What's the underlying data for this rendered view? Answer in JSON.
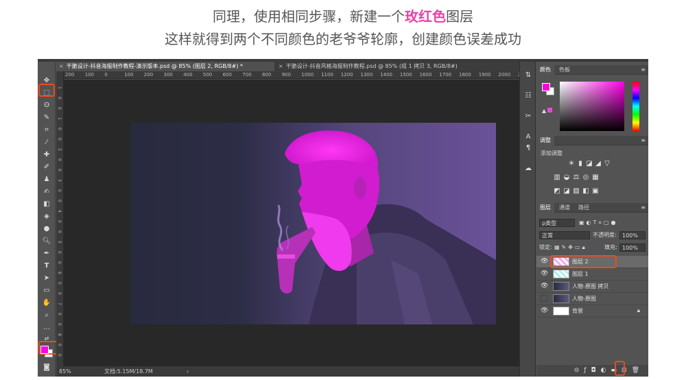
{
  "caption": {
    "line1_a": "同理，使用相同步骤，新建一个",
    "line1_hl": "玫红色",
    "line1_b": "图层",
    "line2": "这样就得到两个不同颜色的老爷爷轮廓，创建颜色误差成功"
  },
  "tabs": [
    {
      "close": "×",
      "label": "干脆设计-抖音海报制作教程-演示版本.psd @ 85% (图层 2, RGB/8#) *"
    },
    {
      "close": "×",
      "label": "干脆设计-抖音风格海报制作教程.psd @ 85% (组 1 拷贝 3, RGB/8#)"
    }
  ],
  "ruler_h": [
    "200",
    "100",
    "0",
    "100",
    "200",
    "300",
    "400",
    "500",
    "600",
    "700",
    "800",
    "900",
    "1000",
    "1100",
    "1200",
    "1300",
    "1400",
    "1500",
    "1600",
    "1700",
    "1800",
    "1900",
    "2000",
    "2100"
  ],
  "ruler_v": [
    "1",
    "0",
    "0",
    "1",
    "0",
    "0",
    "2",
    "0",
    "0",
    "3",
    "0",
    "0",
    "4",
    "0",
    "0",
    "5",
    "0",
    "0",
    "6",
    "0",
    "0",
    "7",
    "0",
    "0",
    "8",
    "0",
    "0"
  ],
  "status": {
    "zoom": "85%",
    "doc": "文档:5.15M/18.7M",
    "arrow": "›"
  },
  "color_panel": {
    "tabs": [
      "颜色",
      "色板"
    ],
    "foreground": "#ff00e6",
    "background": "#ffffff"
  },
  "adjust_panel": {
    "tab": "调整",
    "add_label": "添加调整"
  },
  "layers_panel": {
    "tabs": [
      "图层",
      "通道",
      "路径"
    ],
    "kind": "ρ类型",
    "blend_mode": "正常",
    "opacity_label": "不透明度:",
    "opacity_value": "100%",
    "lock_label": "锁定:",
    "fill_label": "填充:",
    "fill_value": "100%",
    "layers": [
      {
        "name": "图层 2",
        "visible": true,
        "selected": true
      },
      {
        "name": "图层 1",
        "visible": true,
        "selected": false
      },
      {
        "name": "人物-原图 拷贝",
        "visible": true,
        "selected": false
      },
      {
        "name": "人物-原图",
        "visible": false,
        "selected": false
      },
      {
        "name": "背景",
        "visible": true,
        "selected": false,
        "locked": true
      }
    ]
  },
  "colors": {
    "accent": "#ec3fa6",
    "highlight": "#f04a1a",
    "magenta": "#ff00e6"
  }
}
